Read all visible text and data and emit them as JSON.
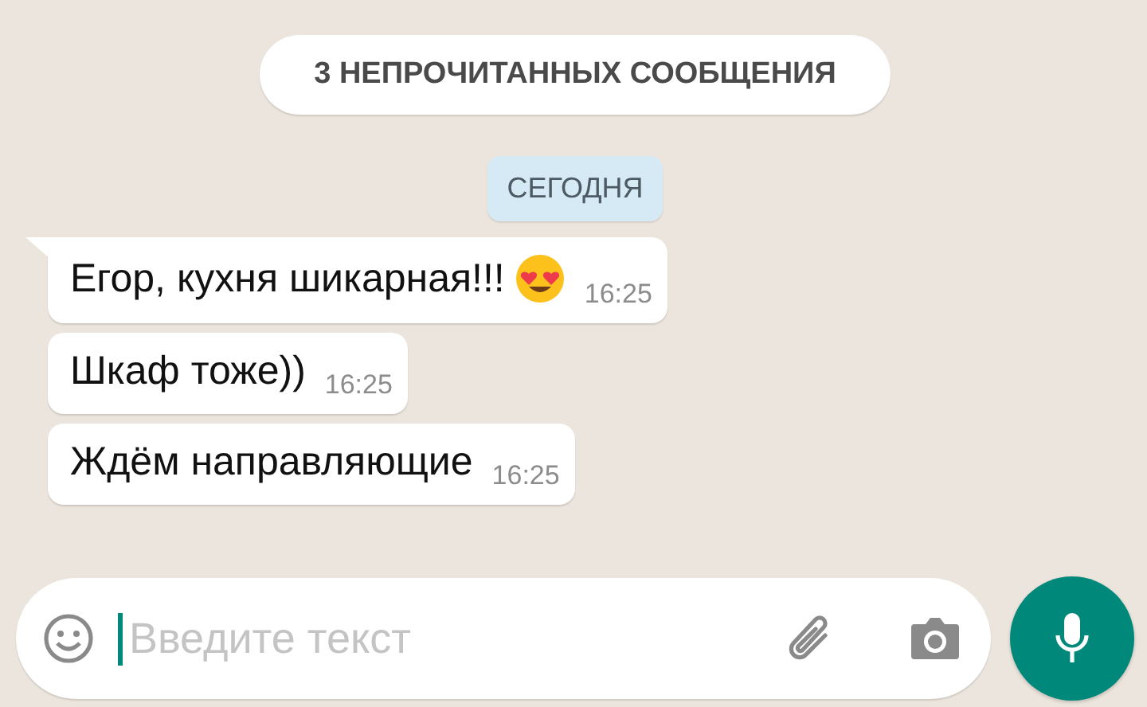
{
  "unread_banner": "3 НЕПРОЧИТАННЫХ СООБЩЕНИЯ",
  "date_chip": "СЕГОДНЯ",
  "messages": [
    {
      "text": "Егор, кухня шикарная!!!",
      "emoji": true,
      "time": "16:25",
      "tail": true
    },
    {
      "text": "Шкаф тоже))",
      "emoji": false,
      "time": "16:25",
      "tail": false
    },
    {
      "text": "Ждём направляющие",
      "emoji": false,
      "time": "16:25",
      "tail": false
    }
  ],
  "composer": {
    "placeholder": "Введите текст"
  }
}
